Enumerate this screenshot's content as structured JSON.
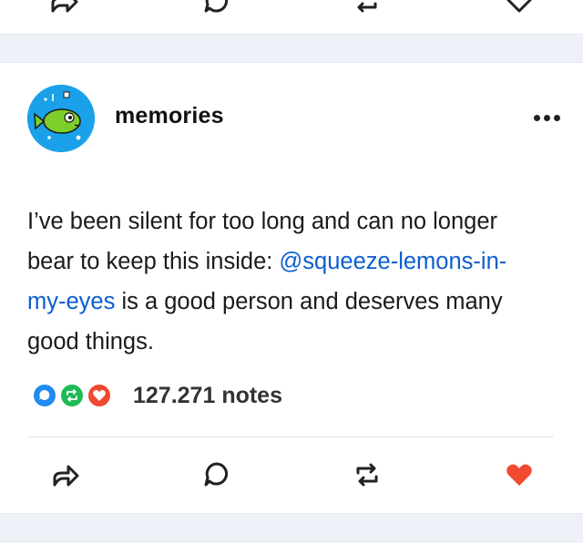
{
  "post": {
    "blog_name": "memories",
    "text_before": "I’ve been silent for too long and can no longer bear to keep this inside: ",
    "mention": "@squeeze-lemons-in-my-eyes",
    "text_after": " is a good person and deserves many good things.",
    "notes_count": "127.271 notes"
  },
  "colors": {
    "mention": "#0b5ecf",
    "like": "#f04a30",
    "reblog": "#1dbb55",
    "reply": "#1f8bf0"
  },
  "icons": {
    "share": "share-icon",
    "reply": "reply-icon",
    "reblog": "reblog-icon",
    "like": "heart-icon",
    "more": "more-icon"
  }
}
